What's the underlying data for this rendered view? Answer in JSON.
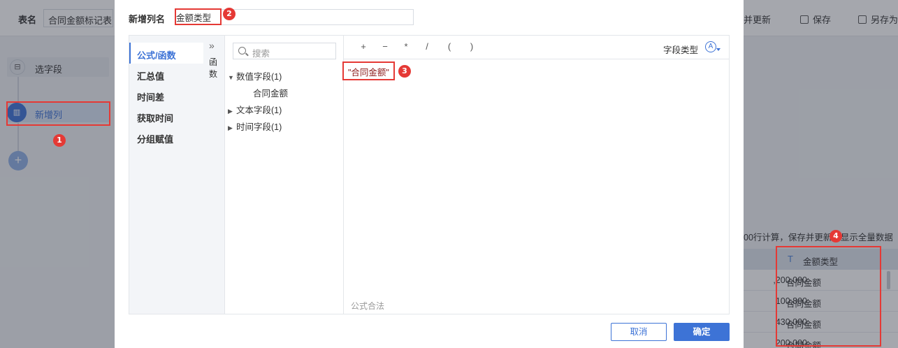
{
  "background": {
    "table_name_label": "表名",
    "table_name_value": "合同金额标记表",
    "actions": [
      "并更新",
      "保存",
      "另存为"
    ],
    "steps": [
      {
        "label": "选字段",
        "icon": "select-field-icon"
      },
      {
        "label": "新增列",
        "icon": "columns-icon"
      }
    ],
    "add_step": "+",
    "hint": "00行计算，保存并更新后显示全量数据",
    "table": {
      "column_type_icon": "T",
      "column_header": "金额类型",
      "numbers": [
        ",200,000",
        "100,800",
        "430,000",
        "200,000"
      ],
      "values": [
        "合同金额",
        "合同金额",
        "合同金额",
        "合同金额"
      ]
    }
  },
  "dialog": {
    "title": "新增列名",
    "name_value": "金额类型",
    "categories": [
      "公式/函数",
      "汇总值",
      "时间差",
      "获取时间",
      "分组赋值"
    ],
    "function_toggle": "»",
    "function_label": "函数",
    "search_placeholder": "搜索",
    "field_tree": [
      {
        "label": "数值字段(1)",
        "expanded": true,
        "children": [
          "合同金额"
        ]
      },
      {
        "label": "文本字段(1)",
        "expanded": false,
        "children": []
      },
      {
        "label": "时间字段(1)",
        "expanded": false,
        "children": []
      }
    ],
    "operators": [
      "+",
      "−",
      "*",
      "/",
      "(",
      ")"
    ],
    "field_type_label": "字段类型",
    "field_type_icon": "A",
    "formula": "\"合同金额\"",
    "formula_status": "公式合法",
    "cancel": "取消",
    "confirm": "确定"
  },
  "annotations": [
    "1",
    "2",
    "3",
    "4"
  ],
  "colors": {
    "accent": "#3d73d6",
    "highlight": "#e53935"
  }
}
